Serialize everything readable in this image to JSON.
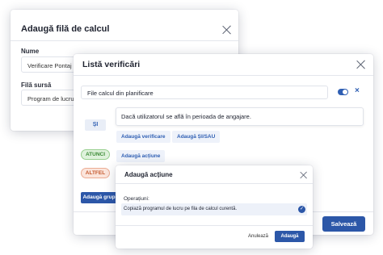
{
  "dialog_add_sheet": {
    "title": "Adaugă filă de calcul",
    "name_label": "Nume",
    "name_value": "Verificare Pontaj",
    "source_label": "Filă sursă",
    "source_value": "Program de lucru"
  },
  "dialog_checklist": {
    "title": "Listă verificări",
    "file_select_value": "File calcul din planificare",
    "remove_icon": "×",
    "si_label": "ȘI",
    "condition_text": "Dacă utilizatorul se află în perioada de angajare.",
    "add_check_label": "Adaugă verificare",
    "add_and_or_label": "Adaugă ȘI/SAU",
    "then_label": "ATUNCI",
    "add_action_label": "Adaugă acțiune",
    "else_label": "ALTFEL",
    "add_group_label": "Adaugă grup",
    "save_label": "Salvează"
  },
  "dialog_add_action": {
    "title": "Adaugă acțiune",
    "operations_label": "Operațiuni:",
    "operation_item": "Copiază programul de lucru pe fila de calcul curentă.",
    "check_icon": "✓",
    "cancel_label": "Anulează",
    "add_label": "Adaugă"
  },
  "colors": {
    "primary": "#2c57a8",
    "then_green": "#3a8a34",
    "else_orange": "#c55a30"
  }
}
